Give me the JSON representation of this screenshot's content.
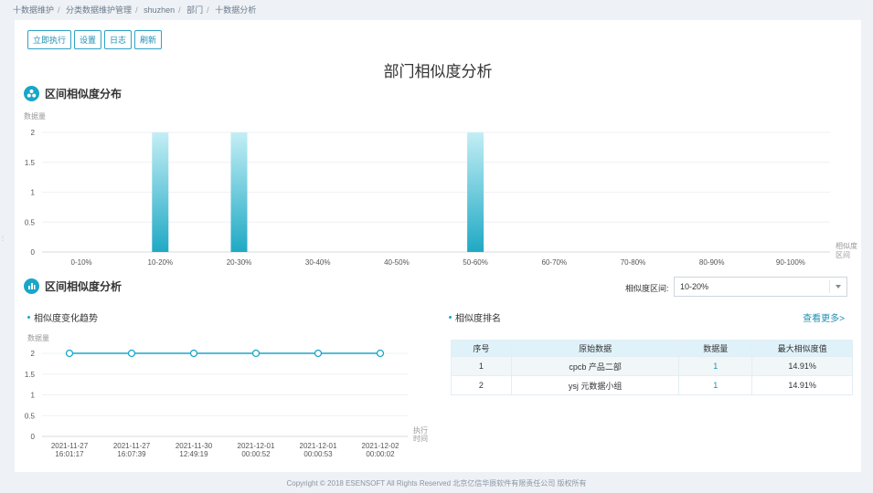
{
  "breadcrumb": [
    "十数据维护",
    "分类数据维护管理",
    "shuzhen",
    "部门",
    "十数据分析"
  ],
  "toolbar": {
    "run_label": "立即执行",
    "settings_label": "设置",
    "log_label": "日志",
    "refresh_label": "刷新"
  },
  "page_title": "部门相似度分析",
  "section1": {
    "title": "区间相似度分布"
  },
  "section2": {
    "title": "区间相似度分析"
  },
  "trend": {
    "title": "相似度变化趋势"
  },
  "ranking": {
    "title": "相似度排名",
    "more_label": "查看更多>",
    "columns": [
      "序号",
      "原始数据",
      "数据量",
      "最大相似度值"
    ],
    "rows": [
      [
        "1",
        "cpcb 产品二部",
        "1",
        "14.91%"
      ],
      [
        "2",
        "ysj 元数据小组",
        "1",
        "14.91%"
      ]
    ]
  },
  "filter": {
    "label": "相似度区间:",
    "value": "10-20%"
  },
  "footer": "Copyright © 2018 ESENSOFT All Rights Reserved 北京亿信华辰软件有限责任公司 版权所有",
  "colors": {
    "accent": "#1aa6c9",
    "bar_top": "#c3eef5",
    "bar_bottom": "#1fa9c4"
  },
  "chart_data": [
    {
      "type": "bar",
      "ylabel": "数据量",
      "xlabel": "相似度区间",
      "categories": [
        "0-10%",
        "10-20%",
        "20-30%",
        "30-40%",
        "40-50%",
        "50-60%",
        "60-70%",
        "70-80%",
        "80-90%",
        "90-100%"
      ],
      "values": [
        0,
        2,
        2,
        0,
        0,
        2,
        0,
        0,
        0,
        0
      ],
      "ylim": [
        0,
        2
      ],
      "yticks": [
        "0",
        "0.5",
        "1",
        "1.5",
        "2"
      ],
      "grid": true
    },
    {
      "type": "line",
      "ylabel": "数据量",
      "xlabel": "执行时间",
      "x": [
        [
          "2021-11-27",
          "16:01:17"
        ],
        [
          "2021-11-27",
          "16:07:39"
        ],
        [
          "2021-11-30",
          "12:49:19"
        ],
        [
          "2021-12-01",
          "00:00:52"
        ],
        [
          "2021-12-01",
          "00:00:53"
        ],
        [
          "2021-12-02",
          "00:00:02"
        ]
      ],
      "values": [
        2,
        2,
        2,
        2,
        2,
        2
      ],
      "ylim": [
        0,
        2
      ],
      "yticks": [
        "0",
        "0.5",
        "1",
        "1.5",
        "2"
      ],
      "grid": true
    }
  ]
}
